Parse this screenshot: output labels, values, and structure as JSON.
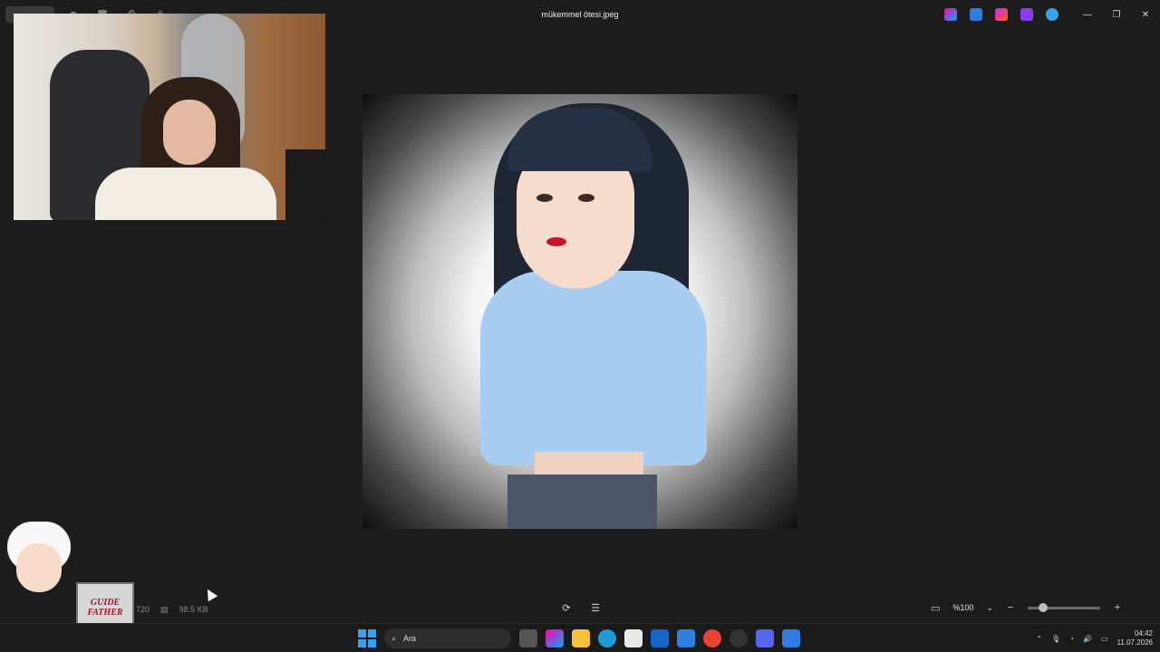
{
  "window": {
    "title": "mükemmel ötesi.jpeg",
    "controls": {
      "minimize": "—",
      "maximize": "❐",
      "close": "✕"
    }
  },
  "statusbar": {
    "dimensions": "720",
    "file_size": "98.5 KB",
    "zoom": "%100"
  },
  "overlay": {
    "sign_text": "GUIDE FATHER"
  },
  "taskbar": {
    "search_placeholder": "Ara",
    "time": "04:42",
    "date": "11.07.2026"
  },
  "colors": {
    "background": "#1c1c1c",
    "accent": "#3aa0f0"
  }
}
